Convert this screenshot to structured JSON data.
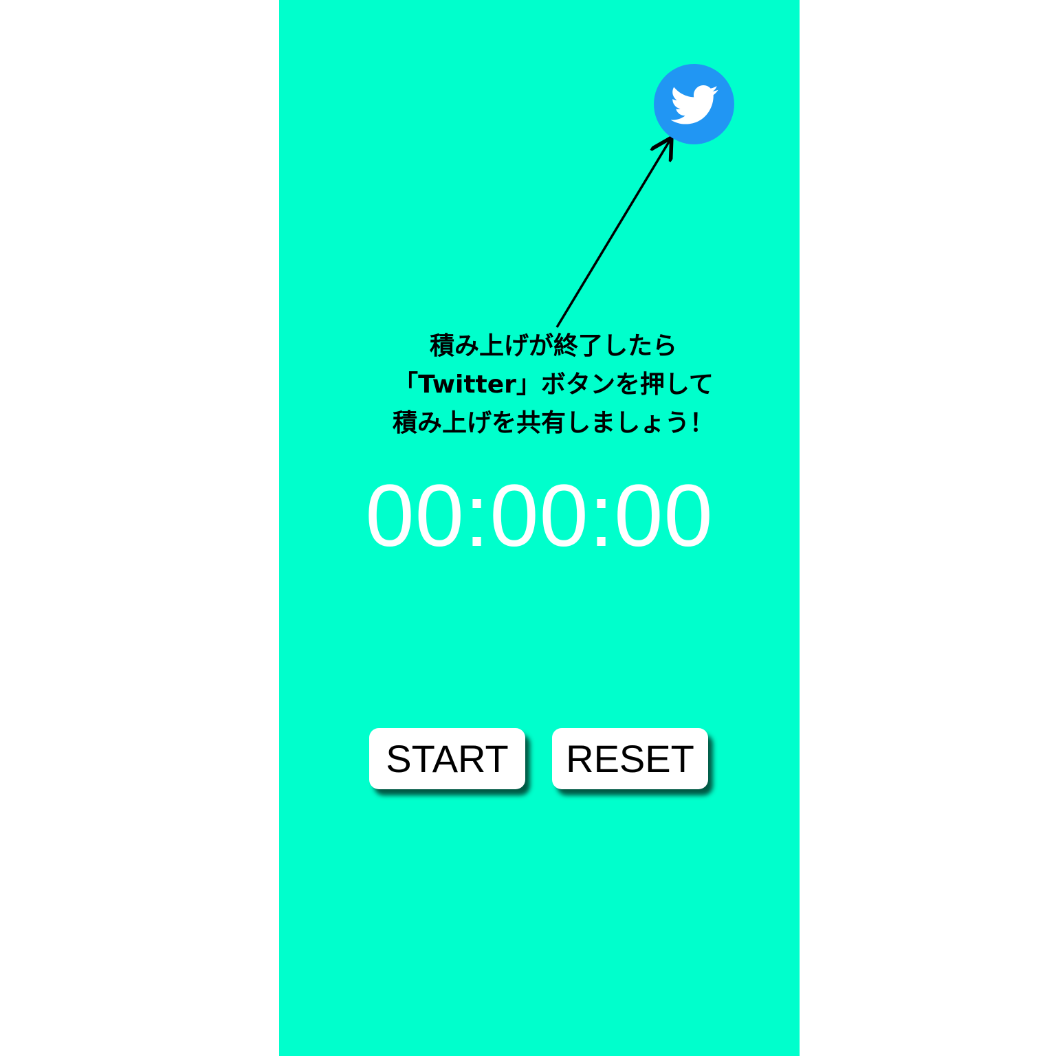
{
  "screen": {
    "background_color": "#00ffcc"
  },
  "share": {
    "icon": "twitter-bird-icon",
    "button_color": "#2196f3"
  },
  "instruction": {
    "line1": "積み上げが終了したら",
    "line2": "「Twitter」ボタンを押して",
    "line3": "積み上げを共有しましょう！"
  },
  "timer": {
    "display": "00:00:00"
  },
  "controls": {
    "start_label": "START",
    "reset_label": "RESET"
  }
}
